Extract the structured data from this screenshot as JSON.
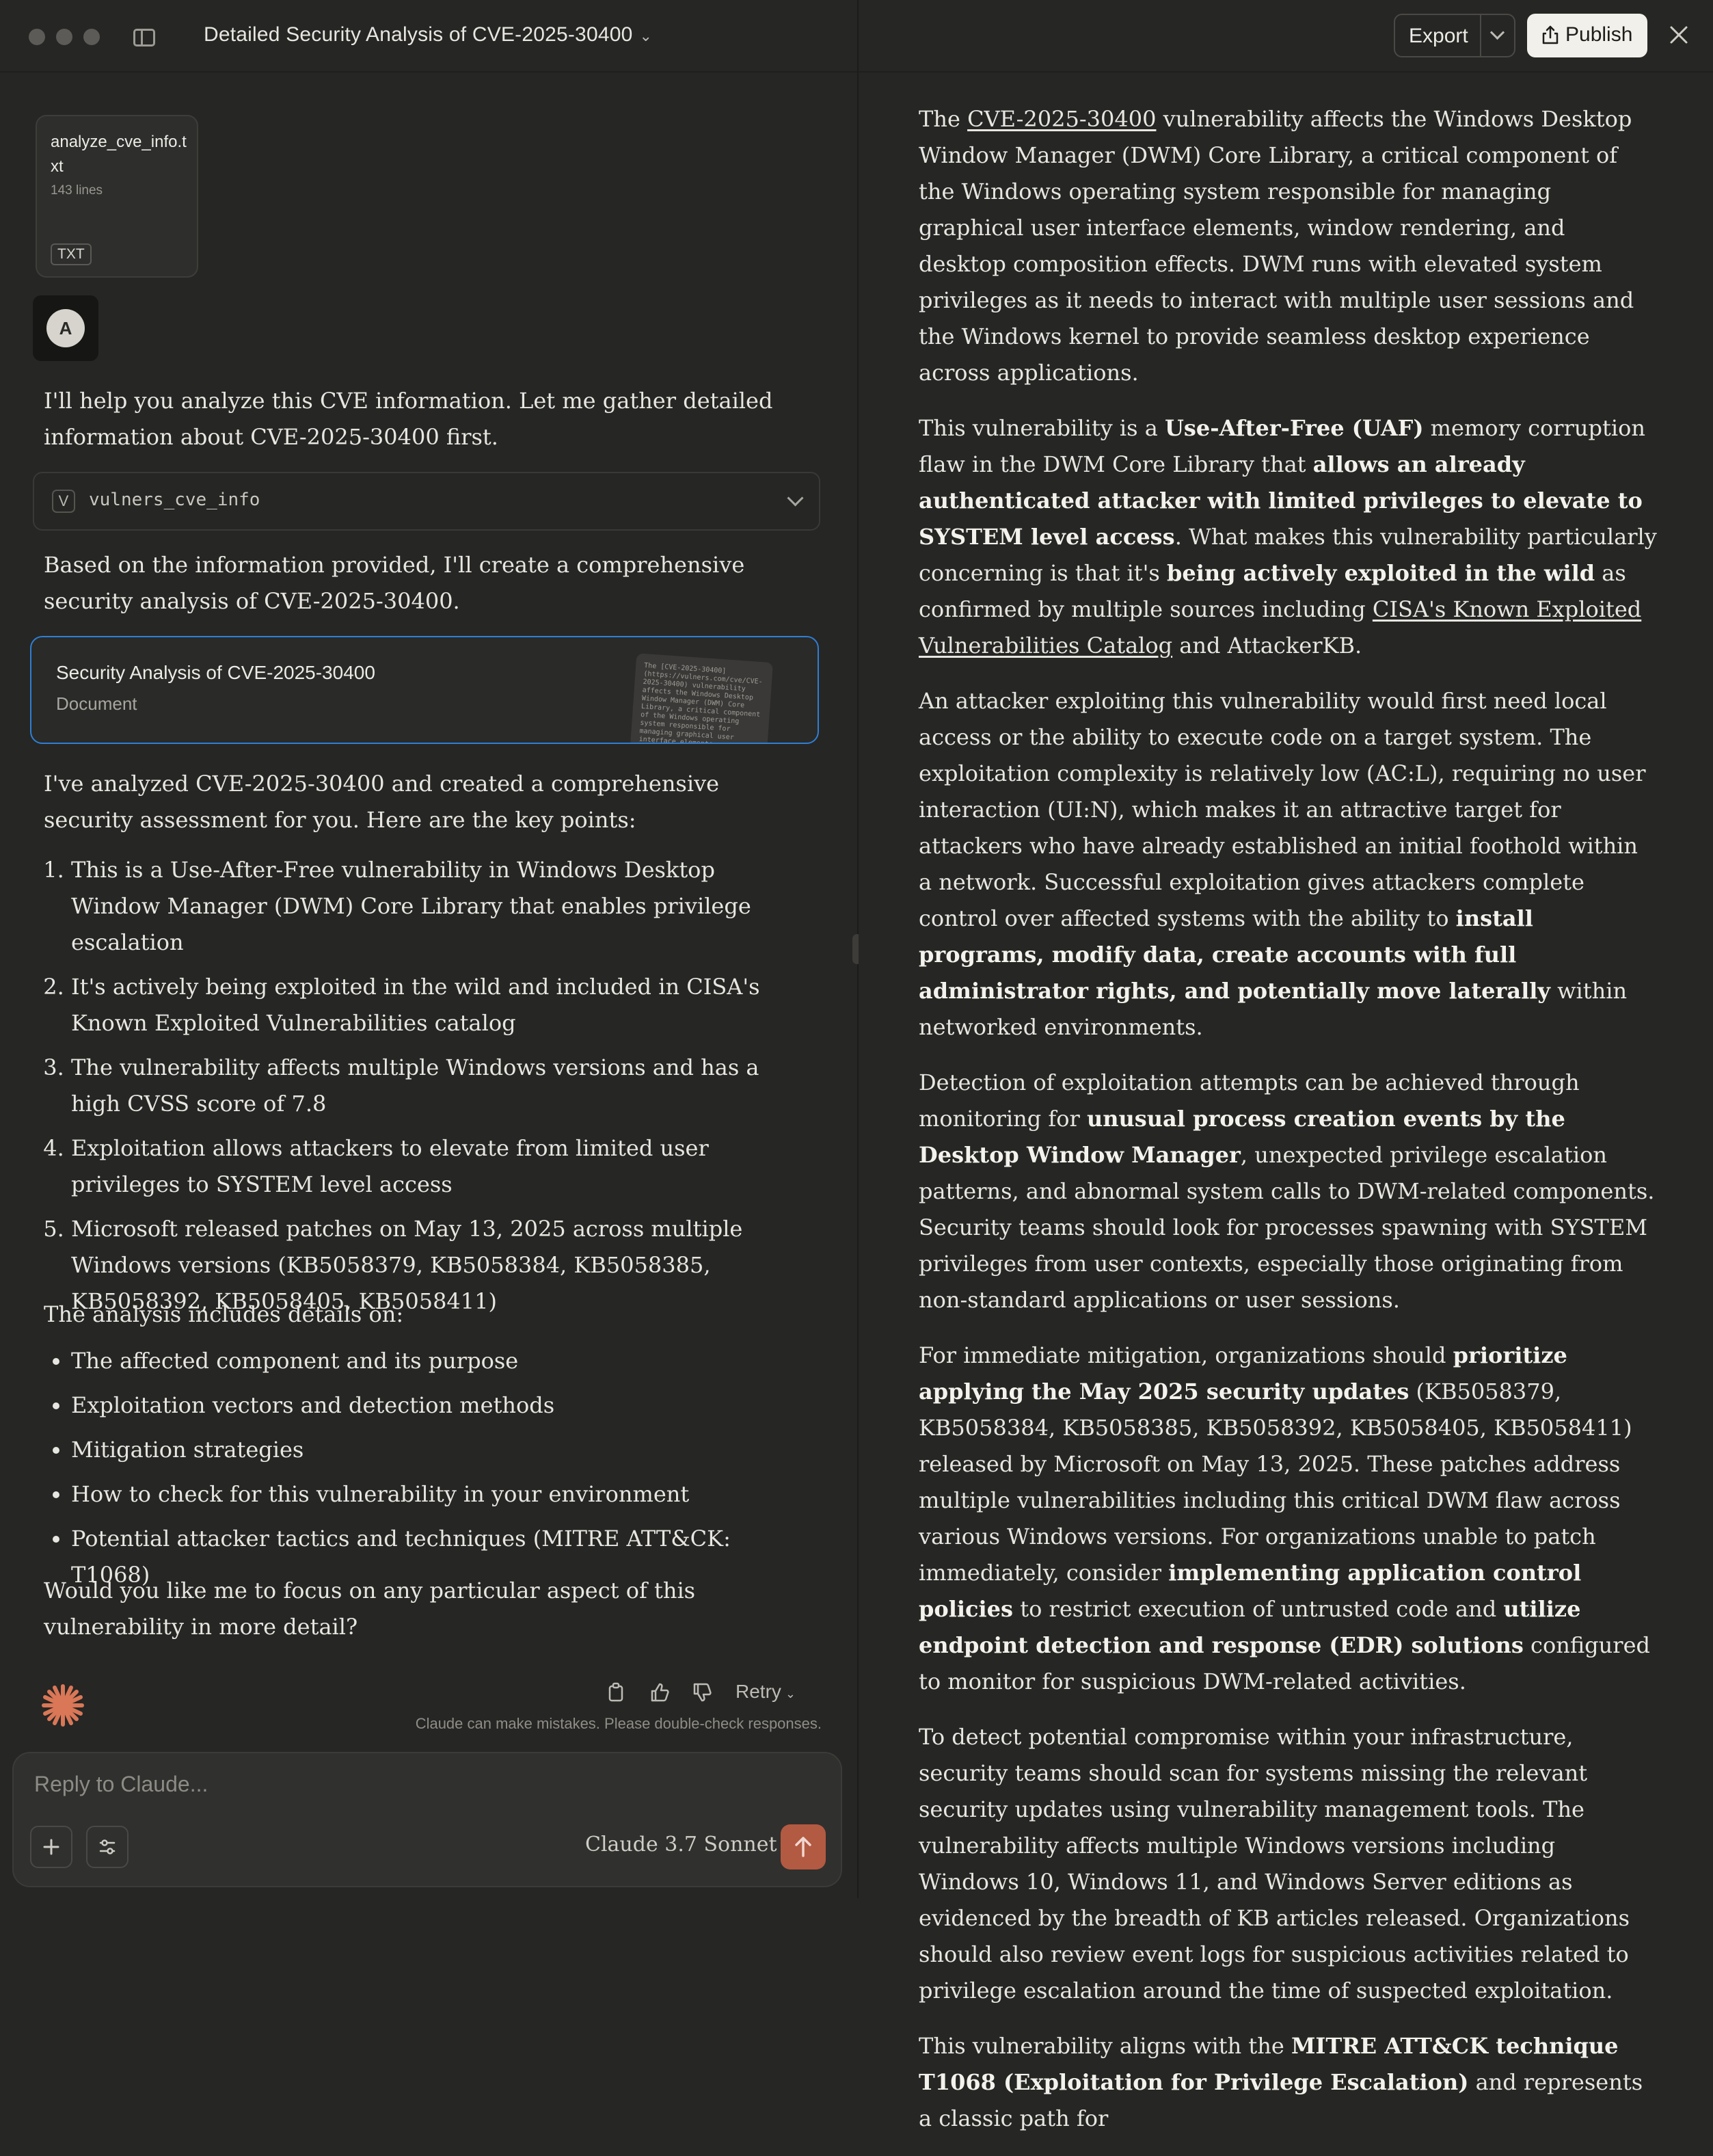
{
  "header": {
    "title": "Detailed Security Analysis of CVE-2025-30400"
  },
  "attachment": {
    "name": "analyze_cve_info.txt",
    "lines": "143 lines",
    "type": "TXT"
  },
  "user": {
    "avatar_letter": "A"
  },
  "chat": {
    "msg1": "I'll help you analyze this CVE information. Let me gather detailed information about CVE-2025-30400 first.",
    "tool_letter": "V",
    "tool_name": "vulners_cve_info",
    "msg2": "Based on the information provided, I'll create a comprehensive security analysis of CVE-2025-30400.",
    "artifact_title": "Security Analysis of CVE-2025-30400",
    "artifact_type": "Document",
    "artifact_preview": "The [CVE-2025-30400](https://vulners.com/cve/CVE-2025-30400) vulnerability affects the Windows Desktop Window Manager (DWM) Core Library, a critical component of the Windows operating system responsible for managing graphical user interface elements",
    "msg3": "I've analyzed CVE-2025-30400 and created a comprehensive security assessment for you. Here are the key points:",
    "key_points": [
      "This is a Use-After-Free vulnerability in Windows Desktop Window Manager (DWM) Core Library that enables privilege escalation",
      "It's actively being exploited in the wild and included in CISA's Known Exploited Vulnerabilities catalog",
      "The vulnerability affects multiple Windows versions and has a high CVSS score of 7.8",
      "Exploitation allows attackers to elevate from limited user privileges to SYSTEM level access",
      "Microsoft released patches on May 13, 2025 across multiple Windows versions (KB5058379, KB5058384, KB5058385, KB5058392, KB5058405, KB5058411)"
    ],
    "msg4": "The analysis includes details on:",
    "details": [
      "The affected component and its purpose",
      "Exploitation vectors and detection methods",
      "Mitigation strategies",
      "How to check for this vulnerability in your environment",
      "Potential attacker tactics and techniques (MITRE ATT&CK: T1068)"
    ],
    "msg5": "Would you like me to focus on any particular aspect of this vulnerability in more detail?",
    "retry_label": "Retry",
    "disclaimer": "Claude can make mistakes. Please double-check responses."
  },
  "composer": {
    "placeholder": "Reply to Claude...",
    "model": "Claude 3.7 Sonnet"
  },
  "artifact_header": {
    "export_label": "Export",
    "publish_label": "Publish"
  },
  "document": {
    "p1": [
      {
        "t": "The ",
        "s": "n"
      },
      {
        "t": "CVE-2025-30400",
        "s": "u"
      },
      {
        "t": " vulnerability affects the Windows Desktop Window Manager (DWM) Core Library, a critical component of the Windows operating system responsible for managing graphical user interface elements, window rendering, and desktop composition effects. DWM runs with elevated system privileges as it needs to interact with multiple user sessions and the Windows kernel to provide seamless desktop experience across applications.",
        "s": "n"
      }
    ],
    "p2": [
      {
        "t": "This vulnerability is a ",
        "s": "n"
      },
      {
        "t": "Use-After-Free (UAF)",
        "s": "b"
      },
      {
        "t": " memory corruption flaw in the DWM Core Library that ",
        "s": "n"
      },
      {
        "t": "allows an already authenticated attacker with limited privileges to elevate to SYSTEM level access",
        "s": "b"
      },
      {
        "t": ". What makes this vulnerability particularly concerning is that it's ",
        "s": "n"
      },
      {
        "t": "being actively exploited in the wild",
        "s": "b"
      },
      {
        "t": " as confirmed by multiple sources including ",
        "s": "n"
      },
      {
        "t": "CISA's Known Exploited Vulnerabilities Catalog",
        "s": "u"
      },
      {
        "t": " and AttackerKB.",
        "s": "n"
      }
    ],
    "p3": [
      {
        "t": "An attacker exploiting this vulnerability would first need local access or the ability to execute code on a target system. The exploitation complexity is relatively low (AC:L), requiring no user interaction (UI:N), which makes it an attractive target for attackers who have already established an initial foothold within a network. Successful exploitation gives attackers complete control over affected systems with the ability to ",
        "s": "n"
      },
      {
        "t": "install programs, modify data, create accounts with full administrator rights, and potentially move laterally",
        "s": "b"
      },
      {
        "t": " within networked environments.",
        "s": "n"
      }
    ],
    "p4": [
      {
        "t": "Detection of exploitation attempts can be achieved through monitoring for ",
        "s": "n"
      },
      {
        "t": "unusual process creation events by the Desktop Window Manager",
        "s": "b"
      },
      {
        "t": ", unexpected privilege escalation patterns, and abnormal system calls to DWM-related components. Security teams should look for processes spawning with SYSTEM privileges from user contexts, especially those originating from non-standard applications or user sessions.",
        "s": "n"
      }
    ],
    "p5": [
      {
        "t": "For immediate mitigation, organizations should ",
        "s": "n"
      },
      {
        "t": "prioritize applying the May 2025 security updates",
        "s": "b"
      },
      {
        "t": " (KB5058379, KB5058384, KB5058385, KB5058392, KB5058405, KB5058411) released by Microsoft on May 13, 2025. These patches address multiple vulnerabilities including this critical DWM flaw across various Windows versions. For organizations unable to patch immediately, consider ",
        "s": "n"
      },
      {
        "t": "implementing application control policies",
        "s": "b"
      },
      {
        "t": " to restrict execution of untrusted code and ",
        "s": "n"
      },
      {
        "t": "utilize endpoint detection and response (EDR) solutions",
        "s": "b"
      },
      {
        "t": " configured to monitor for suspicious DWM-related activities.",
        "s": "n"
      }
    ],
    "p6": [
      {
        "t": "To detect potential compromise within your infrastructure, security teams should scan for systems missing the relevant security updates using vulnerability management tools. The vulnerability affects multiple Windows versions including Windows 10, Windows 11, and Windows Server editions as evidenced by the breadth of KB articles released. Organizations should also review event logs for suspicious activities related to privilege escalation around the time of suspected exploitation.",
        "s": "n"
      }
    ],
    "p7": [
      {
        "t": "This vulnerability aligns with the ",
        "s": "n"
      },
      {
        "t": "MITRE ATT&CK technique T1068 (Exploitation for Privilege Escalation)",
        "s": "b"
      },
      {
        "t": " and represents a classic path for",
        "s": "n"
      }
    ]
  },
  "colors": {
    "accent_border": "#2f7fd6",
    "send_button": "#b35a42",
    "claude_logo": "#d97757",
    "background": "#262624"
  },
  "icons": [
    "sidebar-toggle-icon",
    "chevron-down-icon",
    "copy-icon",
    "thumbs-up-icon",
    "thumbs-down-icon",
    "plus-icon",
    "sliders-icon",
    "arrow-up-icon",
    "share-icon",
    "close-icon",
    "claude-logo-icon"
  ]
}
